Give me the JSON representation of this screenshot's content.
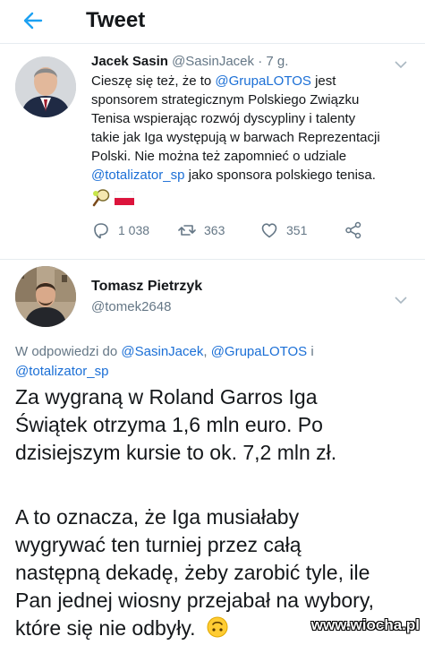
{
  "header": {
    "title": "Tweet",
    "back_icon": "arrow-left-icon"
  },
  "tweet1": {
    "name": "Jacek Sasin",
    "handle": "@SasinJacek",
    "time": "· 7 g.",
    "lines": [
      {
        "pre": "Cieszę się też, że to ",
        "link": "@GrupaLOTOS",
        "post": " jest"
      },
      {
        "pre": "sponsorem strategicznym Polskiego Związku",
        "link": "",
        "post": ""
      },
      {
        "pre": "Tenisa wspierając rozwój dyscypliny i talenty",
        "link": "",
        "post": ""
      },
      {
        "pre": "takie jak Iga występują w barwach Reprezentacji",
        "link": "",
        "post": ""
      },
      {
        "pre": "Polski. Nie można też zapomnieć o udziale",
        "link": "",
        "post": ""
      },
      {
        "pre": "",
        "link": "@totalizator_sp",
        "post": " jako sponsora polskiego tenisa."
      }
    ],
    "emoji": [
      "tennis-racket-icon",
      "poland-flag-icon"
    ],
    "replies": "1 038",
    "retweets": "363",
    "likes": "351"
  },
  "tweet2": {
    "name": "Tomasz Pietrzyk",
    "handle": "@tomek2648",
    "reply_prefix": "W odpowiedzi do ",
    "reply_to_1": "@SasinJacek",
    "reply_sep": ", ",
    "reply_to_2": "@GrupaLOTOS",
    "reply_and": " i",
    "reply_to_3": "@totalizator_sp",
    "paragraph1": [
      "Za wygraną w Roland Garros Iga",
      "Świątek otrzyma 1,6 mln euro. Po",
      "dzisiejszym kursie to ok. 7,2 mln zł."
    ],
    "paragraph2": [
      "A to oznacza, że Iga musiałaby",
      "wygrywać ten turniej przez całą",
      "następną dekadę, żeby zarobić tyle, ile",
      "Pan jednej wiosny przejabał na wybory,",
      "które się nie odbyły."
    ],
    "end_emoji": "upside-down-face-icon"
  },
  "watermark": "www.wiocha.pl"
}
